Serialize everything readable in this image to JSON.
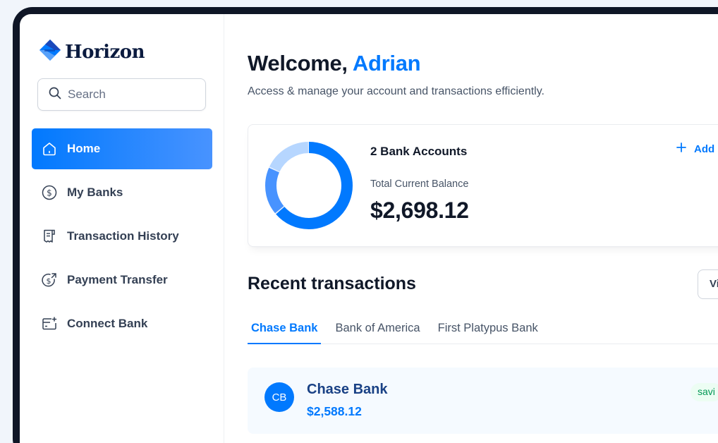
{
  "brand": {
    "name": "Horizon"
  },
  "search": {
    "placeholder": "Search",
    "value": ""
  },
  "sidebar": {
    "items": [
      {
        "label": "Home",
        "icon": "home-icon",
        "active": true
      },
      {
        "label": "My Banks",
        "icon": "dollar-circle-icon",
        "active": false
      },
      {
        "label": "Transaction History",
        "icon": "receipt-icon",
        "active": false
      },
      {
        "label": "Payment Transfer",
        "icon": "money-send-icon",
        "active": false
      },
      {
        "label": "Connect Bank",
        "icon": "card-add-icon",
        "active": false
      }
    ]
  },
  "header": {
    "greeting": "Welcome,",
    "user_name": "Adrian",
    "subtitle": "Access & manage your account and transactions efficiently."
  },
  "balance": {
    "accounts_label": "2 Bank Accounts",
    "total_label": "Total Current Balance",
    "total_value": "$2,698.12",
    "add_label": "Add",
    "donut_segments": [
      {
        "fraction": 0.64,
        "color": "#0179fe"
      },
      {
        "fraction": 0.18,
        "color": "#4893ff"
      },
      {
        "fraction": 0.18,
        "color": "#b6d6ff"
      }
    ],
    "donut_track_color": "#e9f2ff"
  },
  "recent": {
    "title": "Recent transactions",
    "view_all_label": "Vi",
    "tabs": [
      {
        "label": "Chase Bank",
        "active": true
      },
      {
        "label": "Bank of America",
        "active": false
      },
      {
        "label": "First Platypus Bank",
        "active": false
      }
    ],
    "bank": {
      "initials": "CB",
      "name": "Chase Bank",
      "amount": "$2,588.12",
      "badge": "savi"
    }
  },
  "colors": {
    "accent": "#0179fe",
    "accent_light": "#4893ff",
    "heading": "#101828",
    "badge_bg": "#ecfdf3",
    "badge_text": "#039855"
  }
}
